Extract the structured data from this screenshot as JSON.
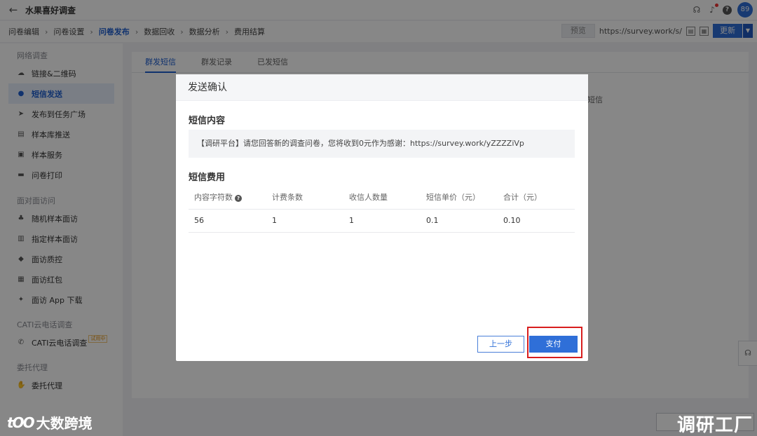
{
  "window": {
    "title": "水果喜好调查",
    "avatar_text": "89"
  },
  "steps": [
    {
      "label": "问卷编辑"
    },
    {
      "label": "问卷设置"
    },
    {
      "label": "问卷发布"
    },
    {
      "label": "数据回收"
    },
    {
      "label": "数据分析"
    },
    {
      "label": "费用结算"
    }
  ],
  "toolbar": {
    "preview_label": "预览",
    "url": "https://survey.work/s/",
    "update_label": "更新"
  },
  "sidebar": {
    "groups": [
      {
        "label": "网络调查",
        "items": [
          {
            "label": "链接&二维码",
            "icon": "cloud-icon"
          },
          {
            "label": "短信发送",
            "icon": "chat-icon"
          },
          {
            "label": "发布到任务广场",
            "icon": "send-icon"
          },
          {
            "label": "样本库推送",
            "icon": "database-icon"
          },
          {
            "label": "样本服务",
            "icon": "service-icon"
          },
          {
            "label": "问卷打印",
            "icon": "printer-icon"
          }
        ]
      },
      {
        "label": "面对面访问",
        "items": [
          {
            "label": "随机样本面访",
            "icon": "users-icon"
          },
          {
            "label": "指定样本面访",
            "icon": "document-icon"
          },
          {
            "label": "面访质控",
            "icon": "shield-icon"
          },
          {
            "label": "面访红包",
            "icon": "redpacket-icon"
          },
          {
            "label": "面访 App 下载",
            "icon": "android-icon"
          }
        ]
      },
      {
        "label": "CATI云电话调查",
        "items": [
          {
            "label": "CATI云电话调查",
            "icon": "phone-icon",
            "tag": "试用中"
          }
        ]
      },
      {
        "label": "委托代理",
        "items": [
          {
            "label": "委托代理",
            "icon": "handshake-icon"
          }
        ]
      }
    ]
  },
  "main": {
    "tabs": [
      {
        "label": "群发短信"
      },
      {
        "label": "群发记录"
      },
      {
        "label": "已发短信"
      }
    ],
    "background_text": "短信"
  },
  "modal": {
    "title": "发送确认",
    "content_title": "短信内容",
    "sms_text": "【调研平台】请您回答新的调查问卷，您将收到0元作为感谢：https://survey.work/yZZZZiVp",
    "fee_title": "短信费用",
    "table": {
      "headers": [
        "内容字符数",
        "计费条数",
        "收信人数量",
        "短信单价（元）",
        "合计（元）"
      ],
      "rows": [
        [
          "56",
          "1",
          "1",
          "0.1",
          "0.10"
        ]
      ]
    },
    "prev_label": "上一步",
    "pay_label": "支付"
  },
  "watermarks": {
    "left_logo": "tOO",
    "left_text": "大数跨境",
    "right_text": "调研工厂"
  },
  "colors": {
    "accent": "#2f6fd8",
    "highlight_border": "#d81e1e"
  }
}
